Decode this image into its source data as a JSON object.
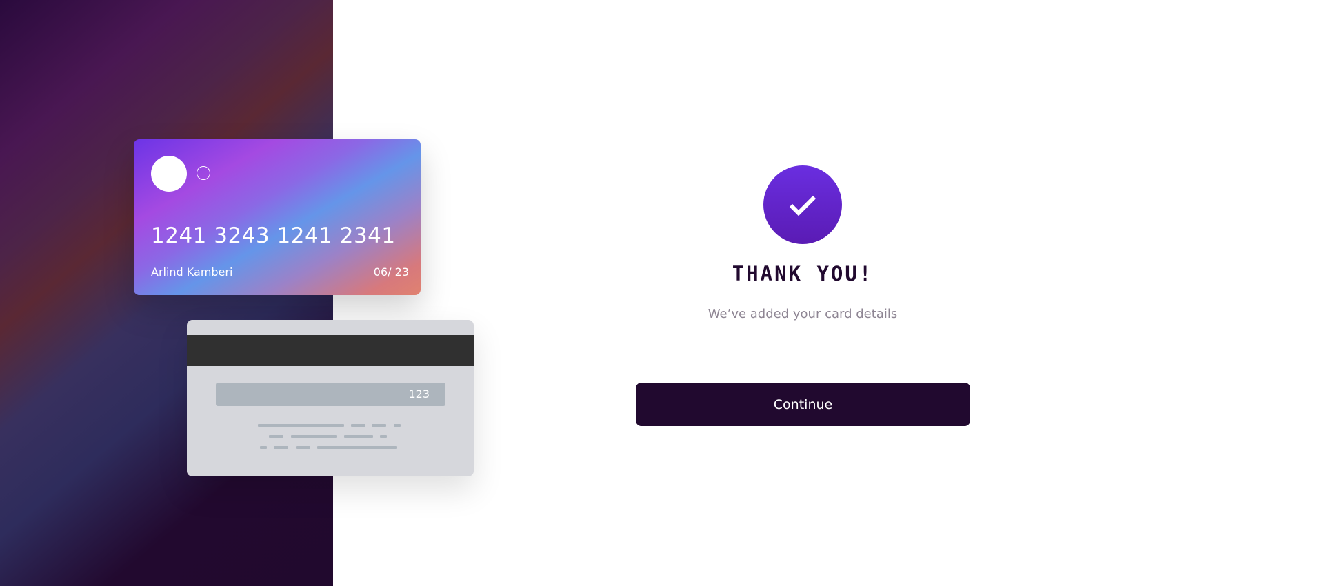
{
  "card_front": {
    "number": "1241 3243 1241 2341",
    "holder": "Arlind Kamberi",
    "expiry": "06/ 23"
  },
  "card_back": {
    "cvc": "123"
  },
  "success": {
    "icon": "check-icon",
    "title": "THANK YOU!",
    "message": "We’ve added your card details",
    "continue_label": "Continue"
  },
  "colors": {
    "dark_purple": "#21092f",
    "accent_purple": "#6a2ee0",
    "muted_text": "#8e8593",
    "card_back_bg": "#d6d7dc",
    "stripe": "#303030"
  }
}
